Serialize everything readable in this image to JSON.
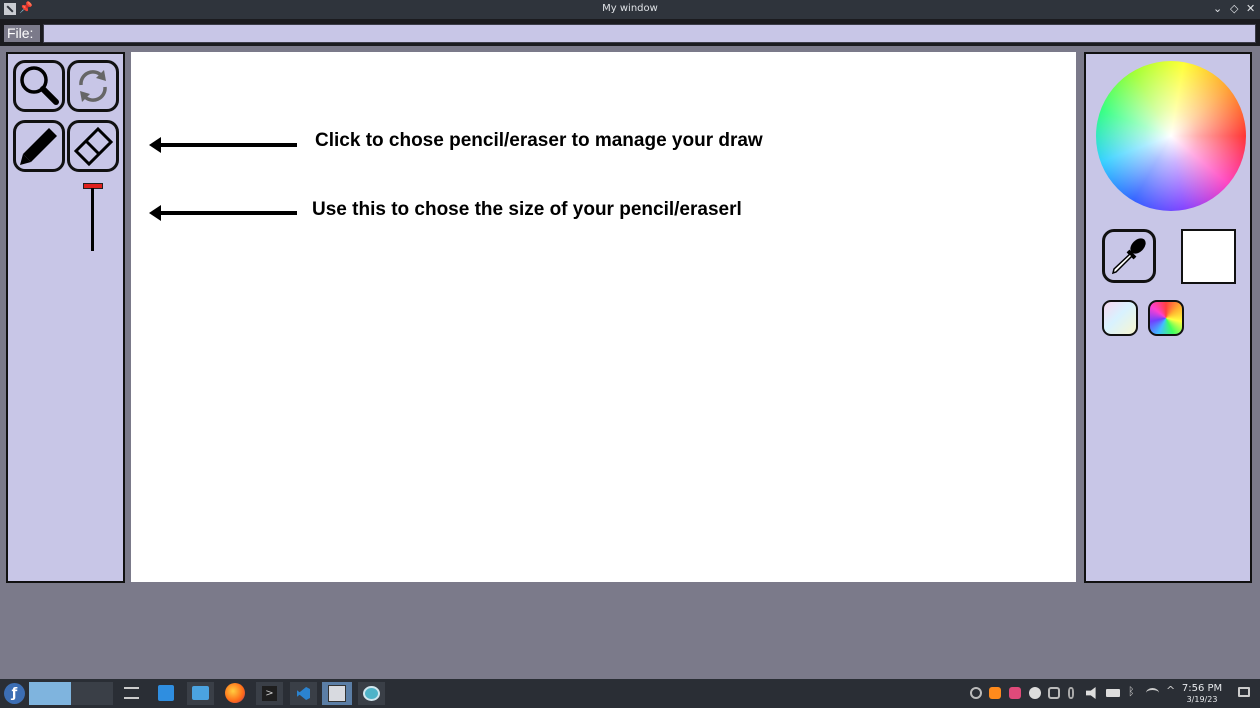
{
  "window": {
    "title": "My window",
    "pin": "📌",
    "controls": {
      "minimize": "⌄",
      "maximize": "◇",
      "close": "✕"
    }
  },
  "filebar": {
    "label": "File:",
    "value": ""
  },
  "left_toolbar": {
    "tools": [
      {
        "icon": "magnifier-icon"
      },
      {
        "icon": "refresh-icon"
      },
      {
        "icon": "pencil-icon"
      },
      {
        "icon": "eraser-icon"
      }
    ],
    "size_slider": {
      "icon": "size-slider",
      "accent": "#e0201c"
    }
  },
  "canvas": {
    "notes": [
      {
        "text": "Click to chose pencil/eraser to manage your draw"
      },
      {
        "text": "Use this to chose the size of your pencil/eraserl"
      }
    ]
  },
  "right_panel": {
    "wheel": "color-wheel",
    "picker": "eyedropper-icon",
    "current_color": "#ffffff",
    "swatches": [
      "pastel-gradient-swatch",
      "rainbow-swatch"
    ]
  },
  "taskbar": {
    "time": "7:56 PM",
    "date": "3/19/23",
    "apps": [
      "fedora-menu-icon",
      "settings-icon",
      "store-icon",
      "files-icon",
      "firefox-icon",
      "terminal-icon",
      "vscode-icon",
      "app-window-icon",
      "screenshot-icon"
    ]
  },
  "colors": {
    "panel": "#c8c6e7",
    "background": "#7b7a8a",
    "taskbar": "#2a2e35",
    "titlebar": "#2f343c"
  }
}
